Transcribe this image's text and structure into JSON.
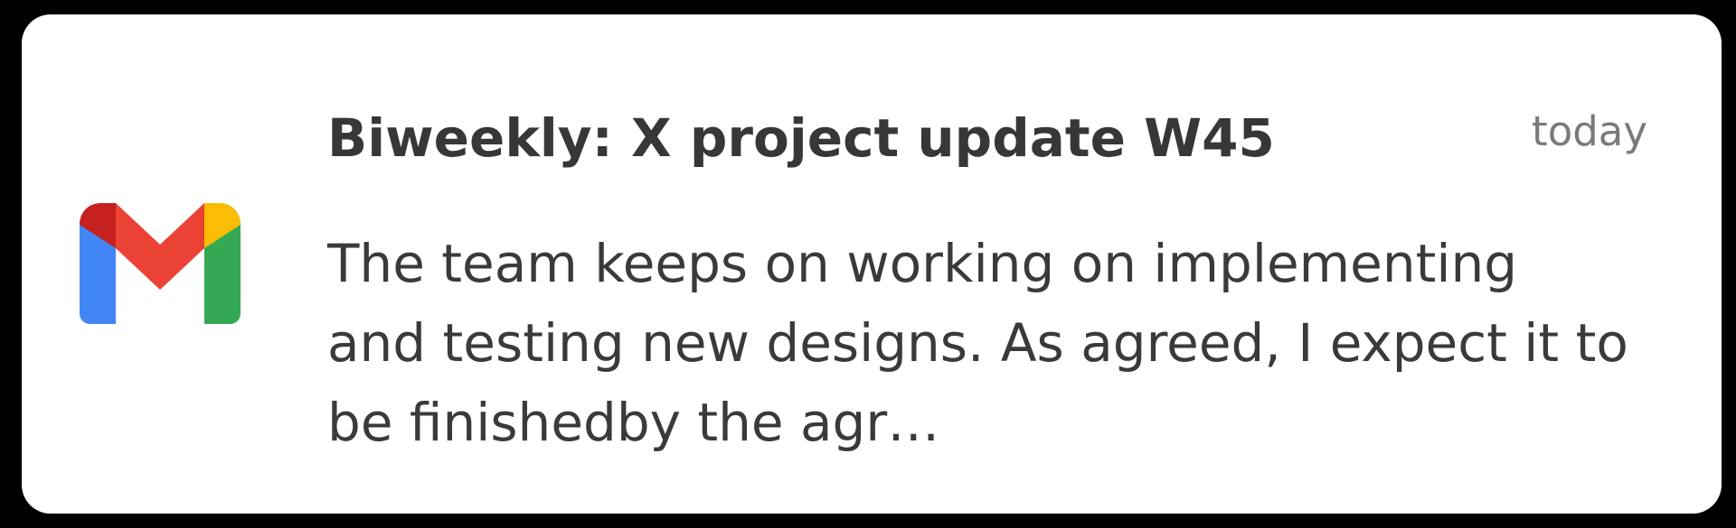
{
  "notification": {
    "app_icon": "gmail-icon",
    "title": "Biweekly: X project update W45",
    "timestamp": "today",
    "preview": "The team keeps on working on implementing and testing new designs. As agreed, I expect it to be finishedby the agr…"
  },
  "colors": {
    "card_background": "#ffffff",
    "frame_background": "#000000",
    "title_text": "#373737",
    "body_text": "#3a3a3a",
    "timestamp_text": "#7a7a7a",
    "gmail_red": "#EA4335",
    "gmail_dark_red": "#C5221F",
    "gmail_blue": "#4285F4",
    "gmail_green": "#34A853",
    "gmail_yellow": "#FBBC04"
  }
}
